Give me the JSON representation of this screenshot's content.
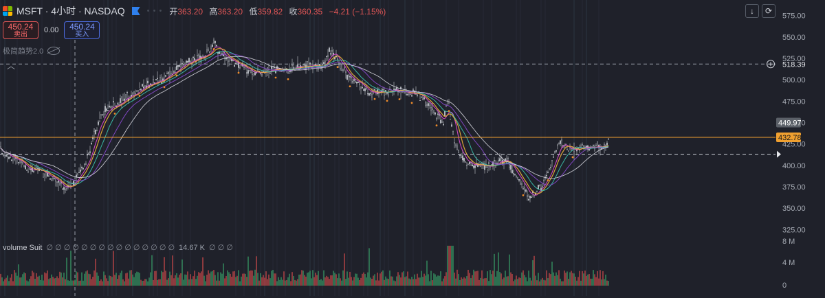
{
  "header": {
    "symbol": "MSFT · 4小时 · NASDAQ",
    "open_label": "开",
    "open": "363.20",
    "high_label": "高",
    "high": "363.20",
    "low_label": "低",
    "low": "359.82",
    "close_label": "收",
    "close": "360.35",
    "change": "−4.21 (−1.15%)"
  },
  "trade": {
    "sell_price": "450.24",
    "sell_label": "卖出",
    "spread": "0.00",
    "buy_price": "450.24",
    "buy_label": "买入"
  },
  "indicator_name": "极简趋势2.0",
  "volume_legend": {
    "title": "volume Suit",
    "slots_before": [
      "∅",
      "∅",
      "∅",
      "∅",
      "∅",
      "∅",
      "∅",
      "∅",
      "∅",
      "∅",
      "∅",
      "∅",
      "∅",
      "∅",
      "∅"
    ],
    "value": "14.67 K",
    "slots_after": [
      "∅",
      "∅",
      "∅"
    ]
  },
  "tools": {
    "down_icon": "↓",
    "reset_icon": "⟳"
  },
  "price_axis": {
    "ticks": [
      "575.00",
      "550.00",
      "525.00",
      "500.00",
      "475.00",
      "450.00",
      "425.00",
      "400.00",
      "375.00",
      "350.00",
      "325.00"
    ],
    "label_last": "449.97",
    "label_orange": "432.78",
    "label_crosshair": "518.39"
  },
  "volume_axis": {
    "ticks": [
      "8 M",
      "4 M",
      "0"
    ]
  },
  "colors": {
    "background": "#1f212a",
    "up": "#d0d3da",
    "down": "#d0d3da",
    "orange_line": "#f0a030",
    "ma_yellow": "#f0b23a",
    "ma_magenta": "#e04cd0",
    "ma_teal": "#3cc6b0",
    "ma_purple": "#8a4ad0",
    "ma_white": "#d8d8e0",
    "dots": "#f08c2a",
    "vol_up": "#3aa56a",
    "vol_down": "#d64c4c"
  },
  "chart_data": {
    "type": "line",
    "y_range": [
      322,
      582
    ],
    "price_anchors": [
      [
        0,
        418
      ],
      [
        10,
        412
      ],
      [
        25,
        405
      ],
      [
        40,
        396
      ],
      [
        60,
        392
      ],
      [
        75,
        386
      ],
      [
        85,
        378
      ],
      [
        95,
        372
      ],
      [
        105,
        380
      ],
      [
        115,
        390
      ],
      [
        125,
        402
      ],
      [
        135,
        432
      ],
      [
        145,
        452
      ],
      [
        155,
        466
      ],
      [
        165,
        470
      ],
      [
        175,
        474
      ],
      [
        185,
        480
      ],
      [
        200,
        488
      ],
      [
        215,
        494
      ],
      [
        230,
        499
      ],
      [
        245,
        506
      ],
      [
        260,
        514
      ],
      [
        275,
        522
      ],
      [
        290,
        526
      ],
      [
        305,
        532
      ],
      [
        312,
        548
      ],
      [
        318,
        531
      ],
      [
        330,
        524
      ],
      [
        345,
        518
      ],
      [
        360,
        512
      ],
      [
        375,
        508
      ],
      [
        390,
        510
      ],
      [
        405,
        514
      ],
      [
        420,
        512
      ],
      [
        430,
        514
      ],
      [
        440,
        517
      ],
      [
        455,
        516
      ],
      [
        465,
        514
      ],
      [
        472,
        520
      ],
      [
        480,
        535
      ],
      [
        488,
        526
      ],
      [
        495,
        516
      ],
      [
        505,
        506
      ],
      [
        515,
        500
      ],
      [
        525,
        492
      ],
      [
        535,
        486
      ],
      [
        545,
        484
      ],
      [
        560,
        486
      ],
      [
        575,
        488
      ],
      [
        590,
        486
      ],
      [
        605,
        484
      ],
      [
        615,
        478
      ],
      [
        625,
        470
      ],
      [
        635,
        458
      ],
      [
        645,
        452
      ],
      [
        652,
        478
      ],
      [
        660,
        430
      ],
      [
        670,
        412
      ],
      [
        680,
        400
      ],
      [
        690,
        402
      ],
      [
        700,
        398
      ],
      [
        710,
        398
      ],
      [
        720,
        402
      ],
      [
        730,
        406
      ],
      [
        740,
        402
      ],
      [
        750,
        388
      ],
      [
        760,
        376
      ],
      [
        770,
        362
      ],
      [
        780,
        370
      ],
      [
        790,
        378
      ],
      [
        800,
        396
      ],
      [
        810,
        420
      ],
      [
        818,
        426
      ],
      [
        825,
        420
      ],
      [
        835,
        416
      ],
      [
        845,
        422
      ],
      [
        855,
        420
      ],
      [
        862,
        420
      ],
      [
        870,
        424
      ],
      [
        878,
        420
      ],
      [
        884,
        430
      ]
    ],
    "volume_max": 8000000
  }
}
